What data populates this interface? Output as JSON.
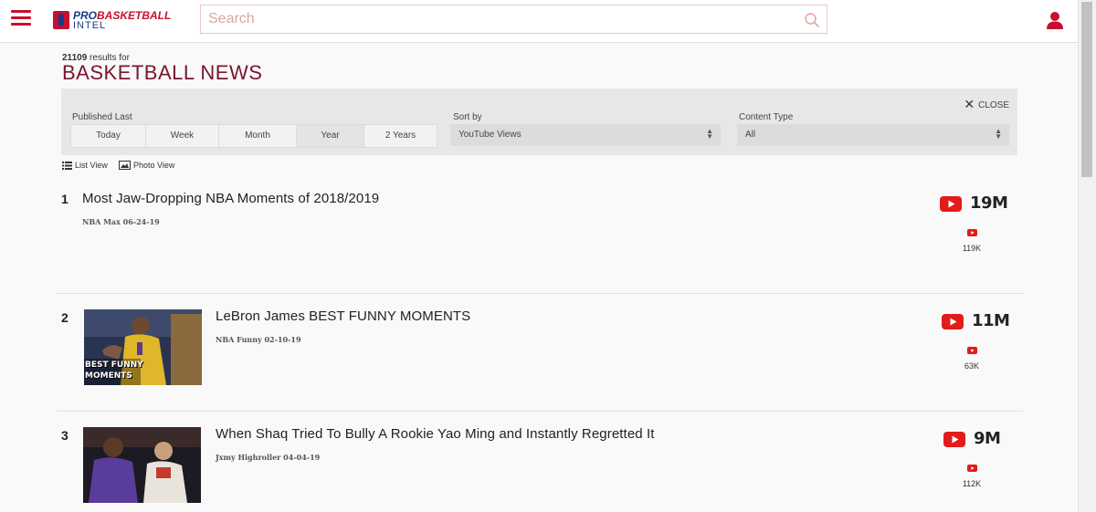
{
  "header": {
    "logo_pro": "PRO",
    "logo_basketball": "BASKETBALL",
    "logo_intel": "INTEL",
    "search_placeholder": "Search"
  },
  "results_header": {
    "count": "21109",
    "count_suffix": "results for",
    "title": "BASKETBALL NEWS"
  },
  "filters": {
    "close_label": "CLOSE",
    "published_last": {
      "label": "Published Last",
      "options": [
        "Today",
        "Week",
        "Month",
        "Year",
        "2 Years"
      ],
      "selected": "Year"
    },
    "sort_by": {
      "label": "Sort by",
      "value": "YouTube Views"
    },
    "content_type": {
      "label": "Content Type",
      "value": "All"
    }
  },
  "view_options": {
    "list": "List View",
    "photo": "Photo View"
  },
  "results": [
    {
      "rank": "1",
      "title": "Most Jaw-Dropping NBA Moments of 2018/2019",
      "meta": "NBA Max 06-24-19",
      "views": "19M",
      "likes": "119K",
      "thumb": ""
    },
    {
      "rank": "2",
      "title": "LeBron James BEST FUNNY MOMENTS",
      "meta": "NBA Funny 02-10-19",
      "views": "11M",
      "likes": "63K",
      "thumb": "BEST FUNNY MOMENTS"
    },
    {
      "rank": "3",
      "title": "When Shaq Tried To Bully A Rookie Yao Ming and Instantly Regretted It",
      "meta": "Jxmy Highroller 04-04-19",
      "views": "9M",
      "likes": "112K",
      "thumb": ""
    }
  ],
  "colors": {
    "brand_red": "#c8102e",
    "brand_blue": "#1a3a8a",
    "title_maroon": "#7a1530",
    "youtube_red": "#e21b1b"
  }
}
